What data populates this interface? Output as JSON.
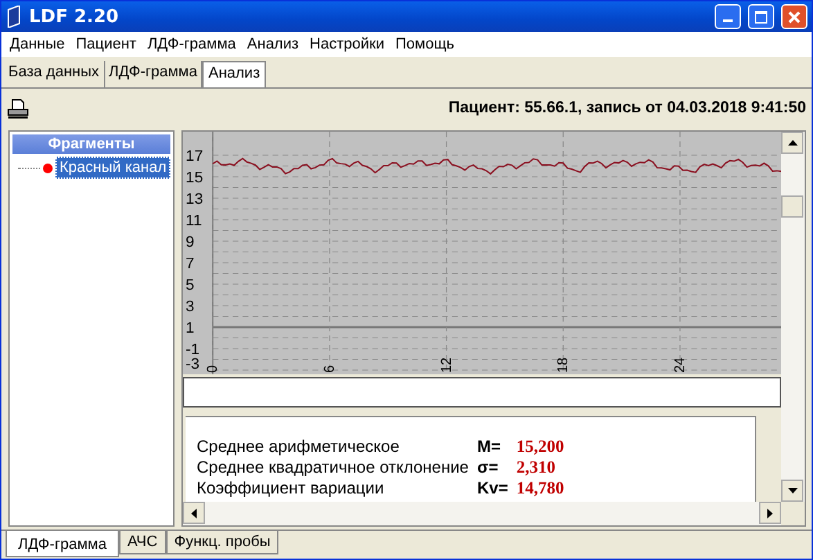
{
  "window": {
    "title": "LDF 2.20"
  },
  "menu": [
    "Данные",
    "Пациент",
    "ЛДФ-грамма",
    "Анализ",
    "Настройки",
    "Помощь"
  ],
  "tabs": [
    {
      "label": "База данных",
      "selected": false
    },
    {
      "label": "ЛДФ-грамма",
      "selected": false
    },
    {
      "label": "Анализ",
      "selected": true
    }
  ],
  "toolbar": {
    "patient_info": "Пациент: 55.66.1, запись от 04.03.2018 9:41:50"
  },
  "fragments": {
    "title": "Фрагменты",
    "items": [
      {
        "label": "Красный канал",
        "selected": true,
        "color": "#ff0000"
      }
    ]
  },
  "chart": {
    "y_ticks": [
      "17",
      "15",
      "13",
      "11",
      "9",
      "7",
      "5",
      "3",
      "1",
      "-1",
      "-3"
    ],
    "x_ticks": [
      "0",
      "6",
      "12",
      "18",
      "24"
    ]
  },
  "stats": [
    {
      "label": "Среднее арифметическое",
      "symbol": "M=",
      "value": "15,200"
    },
    {
      "label": "Среднее квадратичное отклонение",
      "symbol": "σ=",
      "value": "2,310"
    },
    {
      "label": "Коэффициент вариации",
      "symbol": "Kv=",
      "value": "14,780"
    }
  ],
  "bottom_tabs": [
    {
      "label": "ЛДФ-грамма",
      "selected": true
    },
    {
      "label": "АЧС",
      "selected": false
    },
    {
      "label": "Функц. пробы",
      "selected": false
    }
  ]
}
